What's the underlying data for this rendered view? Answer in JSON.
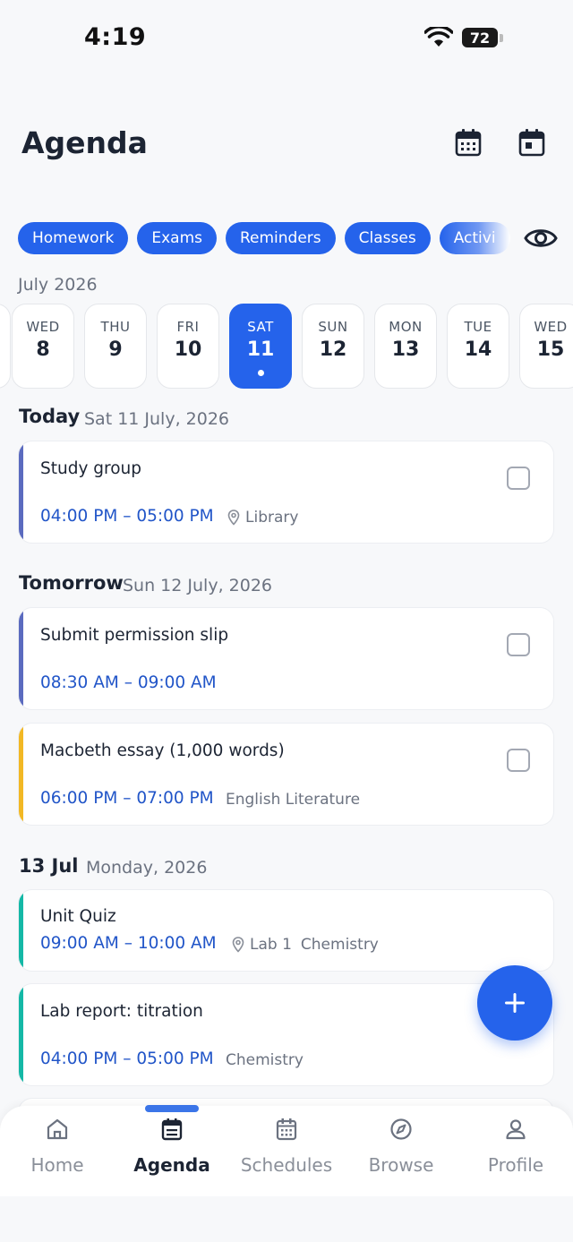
{
  "status": {
    "time": "4:19",
    "battery": "72"
  },
  "header": {
    "title": "Agenda"
  },
  "filters": [
    "Homework",
    "Exams",
    "Reminders",
    "Classes",
    "Activi"
  ],
  "month_label": "July 2026",
  "days": [
    {
      "dow": "WED",
      "num": "8"
    },
    {
      "dow": "THU",
      "num": "9"
    },
    {
      "dow": "FRI",
      "num": "10"
    },
    {
      "dow": "SAT",
      "num": "11"
    },
    {
      "dow": "SUN",
      "num": "12"
    },
    {
      "dow": "MON",
      "num": "13"
    },
    {
      "dow": "TUE",
      "num": "14"
    },
    {
      "dow": "WED",
      "num": "15"
    }
  ],
  "sections": [
    {
      "title": "Today",
      "subtitle": "Sat 11 July, 2026",
      "events": [
        {
          "title": "Study group",
          "time": "04:00 PM – 05:00 PM",
          "location": "Library",
          "subject": ""
        }
      ]
    },
    {
      "title": "Tomorrow",
      "subtitle": "Sun 12 July, 2026",
      "events": [
        {
          "title": "Submit permission slip",
          "time": "08:30 AM – 09:00 AM",
          "location": "",
          "subject": ""
        },
        {
          "title": "Macbeth essay (1,000 words)",
          "time": "06:00 PM – 07:00 PM",
          "location": "",
          "subject": "English Literature"
        }
      ]
    },
    {
      "title": "13 Jul",
      "subtitle": "Monday, 2026",
      "events": [
        {
          "title": "Unit Quiz",
          "time": "09:00 AM – 10:00 AM",
          "location": "Lab 1",
          "subject": "Chemistry"
        },
        {
          "title": "Lab report: titration",
          "time": "04:00 PM – 05:00 PM",
          "location": "",
          "subject": "Chemistry"
        }
      ]
    }
  ],
  "nav": [
    {
      "label": "Home",
      "icon": "home-icon"
    },
    {
      "label": "Agenda",
      "icon": "agenda-icon"
    },
    {
      "label": "Schedules",
      "icon": "calendar-grid-icon"
    },
    {
      "label": "Browse",
      "icon": "compass-icon"
    },
    {
      "label": "Profile",
      "icon": "person-icon"
    }
  ],
  "colors": {
    "accent": "#2563eb",
    "time_text": "#2155c8",
    "stripe_purple": "#5b6bbf",
    "stripe_yellow": "#f2b824",
    "stripe_teal": "#14b8a6"
  }
}
